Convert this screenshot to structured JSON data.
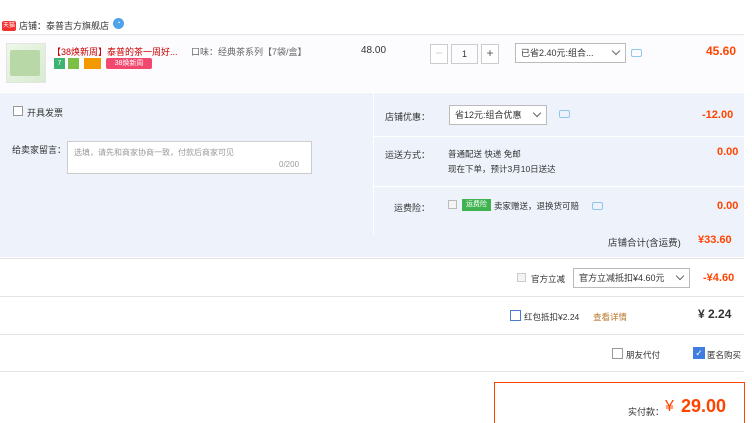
{
  "shop": {
    "badge": "天猫",
    "name": "店铺：泰普吉方旗舰店"
  },
  "item": {
    "title": "【38焕新周】泰普的茶一周好...",
    "tags": [
      "7",
      "",
      "",
      "38焕新周"
    ],
    "flavor": "口味：经典茶系列【7袋/盒】",
    "unit_price": "48.00",
    "qty_minus": "−",
    "qty": "1",
    "qty_plus": "+",
    "promo_select": "已省2.40元:组合...",
    "total": "45.60"
  },
  "panel": {
    "invoice_label": "开具发票",
    "message_label": "给卖家留言：",
    "message_placeholder": "选填，请先和商家协商一致，付款后商家可见",
    "message_count": "0/200",
    "shop_discount_label": "店铺优惠：",
    "shop_discount_select": "省12元:组合优惠",
    "shop_discount_value": "-12.00",
    "shipping_label": "运送方式：",
    "shipping_line1": "普通配送 快递 免邮",
    "shipping_line2": "现在下单，预计3月10日送达",
    "shipping_value": "0.00",
    "insurance_label": "运费险：",
    "insurance_badge": "运费险",
    "insurance_text": "卖家赠送，退换货可赔",
    "insurance_value": "0.00",
    "shop_total_label": "店铺合计(含运费)",
    "shop_total": "¥33.60"
  },
  "official": {
    "label": "官方立减",
    "select": "官方立减抵扣¥4.60元",
    "value": "-¥4.60"
  },
  "redpacket": {
    "label": "红包抵扣¥2.24",
    "link": "查看详情",
    "value": "¥ 2.24"
  },
  "options": {
    "friend_pay": "朋友代付",
    "anonymous": "匿名购买",
    "anonymous_check": "✓"
  },
  "pay": {
    "label": "实付款：",
    "currency": "¥",
    "amount": "29.00"
  },
  "colors": {
    "accent": "#ff4400",
    "panel_bg": "#eef3fb",
    "checkbox_blue": "#3f7de0"
  }
}
